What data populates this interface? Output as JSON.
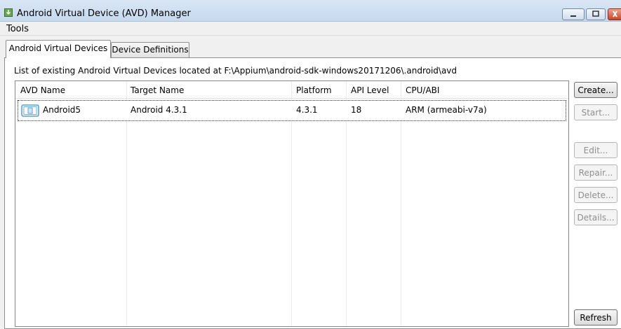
{
  "window": {
    "title": "Android Virtual Device (AVD) Manager"
  },
  "menu": {
    "items": [
      "Tools"
    ]
  },
  "tabs": [
    {
      "label": "Android Virtual Devices",
      "active": true
    },
    {
      "label": "Device Definitions",
      "active": false
    }
  ],
  "description": "List of existing Android Virtual Devices located at F:\\Appium\\android-sdk-windows20171206\\.android\\avd",
  "table": {
    "columns": [
      "AVD Name",
      "Target Name",
      "Platform",
      "API Level",
      "CPU/ABI"
    ],
    "rows": [
      {
        "icon": "device-icon",
        "avd_name": "Android5",
        "target_name": "Android 4.3.1",
        "platform": "4.3.1",
        "api_level": "18",
        "cpu_abi": "ARM (armeabi-v7a)"
      }
    ]
  },
  "buttons": {
    "create": {
      "label": "Create...",
      "enabled": true
    },
    "start": {
      "label": "Start...",
      "enabled": false
    },
    "edit": {
      "label": "Edit...",
      "enabled": false
    },
    "repair": {
      "label": "Repair...",
      "enabled": false
    },
    "delete": {
      "label": "Delete...",
      "enabled": false
    },
    "details": {
      "label": "Details...",
      "enabled": false
    },
    "refresh": {
      "label": "Refresh",
      "enabled": true
    }
  }
}
